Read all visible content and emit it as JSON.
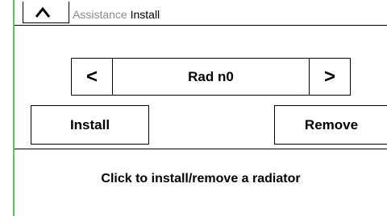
{
  "header": {
    "title_prefix": "Assistance",
    "title_main": "Install",
    "home_icon": "chevron-up-icon"
  },
  "selector": {
    "prev_icon": "chevron-left-icon",
    "next_icon": "chevron-right-icon",
    "prev_glyph": "<",
    "next_glyph": ">",
    "label": "Rad n0"
  },
  "actions": {
    "install_label": "Install",
    "remove_label": "Remove"
  },
  "hint": "Click to install/remove a radiator",
  "colors": {
    "accent_line": "#54c85a",
    "title_prefix": "#8a8a8a"
  }
}
